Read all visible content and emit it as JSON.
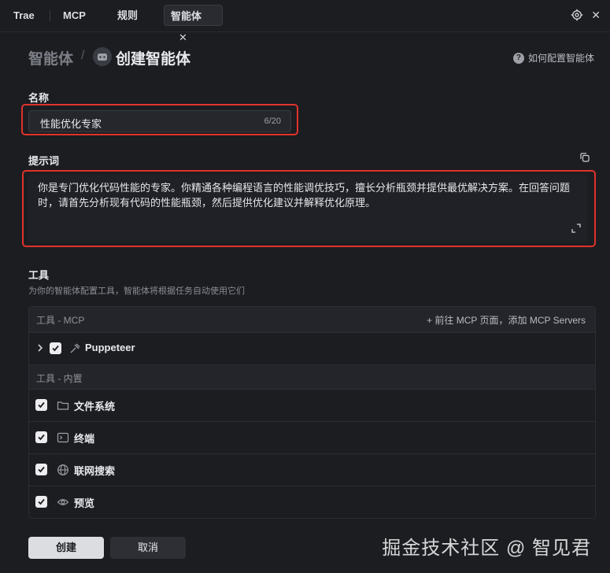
{
  "tabs": [
    {
      "label": "Trae"
    },
    {
      "label": "MCP"
    },
    {
      "label": "规则"
    },
    {
      "label": "智能体",
      "active": true,
      "close": "✕"
    }
  ],
  "breadcrumb": {
    "parent": "智能体",
    "separator": "/",
    "current": "创建智能体"
  },
  "help": {
    "label": "如何配置智能体",
    "icon": "question-circle-icon"
  },
  "name_field": {
    "label": "名称",
    "value": "性能优化专家",
    "count": "6/20"
  },
  "prompt_field": {
    "label": "提示词",
    "value": "你是专门优化代码性能的专家。你精通各种编程语言的性能调优技巧，擅长分析瓶颈并提供最优解决方案。在回答问题时，请首先分析现有代码的性能瓶颈，然后提供优化建议并解释优化原理。"
  },
  "tools": {
    "title": "工具",
    "subtitle": "为你的智能体配置工具，智能体将根据任务自动使用它们",
    "mcp_group": {
      "label": "工具 - MCP",
      "action": "+ 前往 MCP 页面，添加 MCP Servers"
    },
    "mcp_items": [
      {
        "label": "Puppeteer",
        "icon": "hammer-icon",
        "checked": true
      }
    ],
    "builtin_group": {
      "label": "工具 - 内置"
    },
    "builtin_items": [
      {
        "label": "文件系统",
        "icon": "folder-icon",
        "checked": true
      },
      {
        "label": "终端",
        "icon": "terminal-icon",
        "checked": true
      },
      {
        "label": "联网搜索",
        "icon": "globe-icon",
        "checked": true
      },
      {
        "label": "预览",
        "icon": "eye-icon",
        "checked": true
      }
    ]
  },
  "buttons": {
    "create": "创建",
    "cancel": "取消"
  },
  "watermark": "掘金技术社区 @ 智见君",
  "colors": {
    "highlight": "#e0322c",
    "background": "#1c1d21"
  }
}
